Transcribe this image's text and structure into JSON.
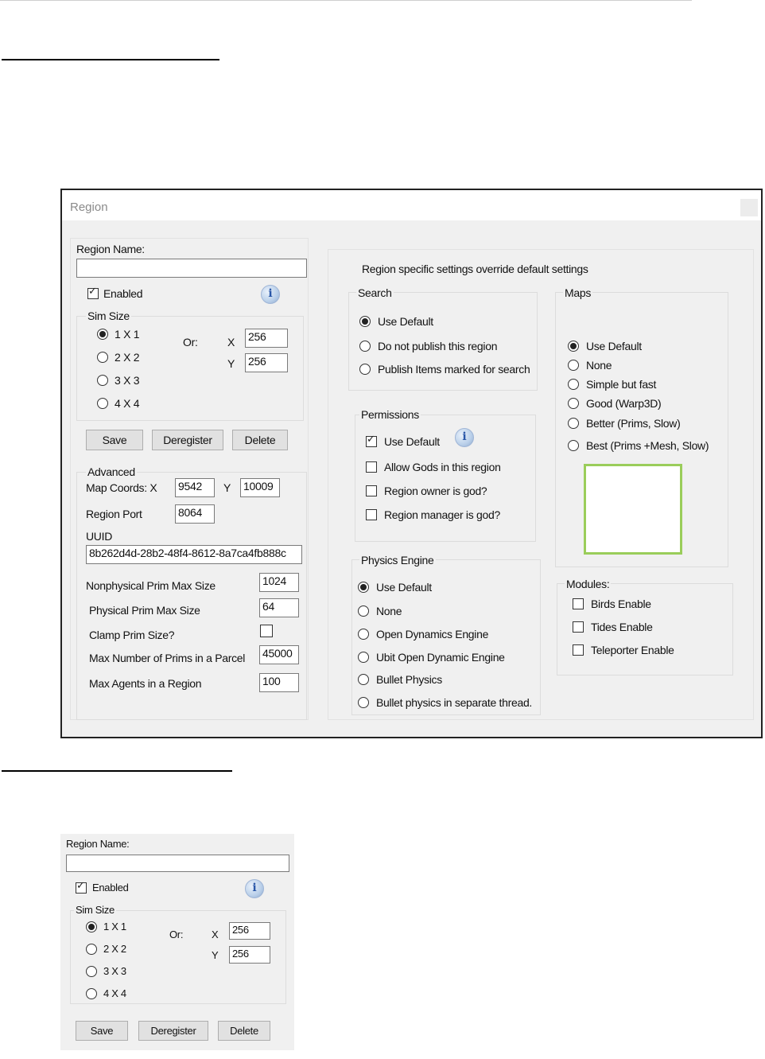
{
  "dialog": {
    "title": "Region",
    "region_name_label": "Region Name:",
    "region_name_value": "",
    "enabled_label": "Enabled",
    "sim_size": {
      "label": "Sim Size",
      "options": [
        "1 X 1",
        "2 X 2",
        "3 X 3",
        "4 X 4"
      ],
      "selected": "1 X 1",
      "or_label": "Or:",
      "x_label": "X",
      "y_label": "Y",
      "x_value": "256",
      "y_value": "256"
    },
    "buttons": {
      "save": "Save",
      "deregister": "Deregister",
      "delete": "Delete"
    },
    "advanced": {
      "label": "Advanced",
      "map_coords_label": "Map Coords: X",
      "map_x": "9542",
      "map_y_label": "Y",
      "map_y": "10009",
      "region_port_label": "Region Port",
      "region_port": "8064",
      "uuid_label": "UUID",
      "uuid": "8b262d4d-28b2-48f4-8612-8a7ca4fb888c",
      "nonphysical_label": "Nonphysical Prim Max Size",
      "nonphysical_value": "1024",
      "physical_label": "Physical Prim Max Size",
      "physical_value": "64",
      "clamp_label": "Clamp Prim Size?",
      "max_prims_label": "Max Number of Prims in a Parcel",
      "max_prims_value": "45000",
      "max_agents_label": "Max Agents in a Region",
      "max_agents_value": "100"
    },
    "override_note": "Region specific settings override default settings",
    "search": {
      "label": "Search",
      "options": [
        "Use Default",
        "Do not publish this region",
        "Publish Items marked for search"
      ],
      "selected": "Use Default"
    },
    "permissions": {
      "label": "Permissions",
      "use_default": "Use Default",
      "options": [
        "Allow Gods in this region",
        "Region owner is god?",
        "Region manager is god?"
      ]
    },
    "physics": {
      "label": "Physics Engine",
      "options": [
        "Use Default",
        "None",
        "Open Dynamics Engine",
        "Ubit Open Dynamic Engine",
        "Bullet Physics",
        "Bullet physics in separate thread."
      ],
      "selected": "Use Default"
    },
    "maps": {
      "label": "Maps",
      "options": [
        "Use Default",
        "None",
        "Simple but fast",
        "Good (Warp3D)",
        "Better (Prims, Slow)",
        "Best (Prims +Mesh, Slow)"
      ],
      "selected": "Use Default"
    },
    "modules": {
      "label": "Modules:",
      "options": [
        "Birds Enable",
        "Tides Enable",
        "Teleporter Enable"
      ]
    }
  },
  "colors": {
    "window_bg": "#f0f0f0",
    "preview_border": "#9acd5a",
    "info_icon": "#2a57a8"
  }
}
